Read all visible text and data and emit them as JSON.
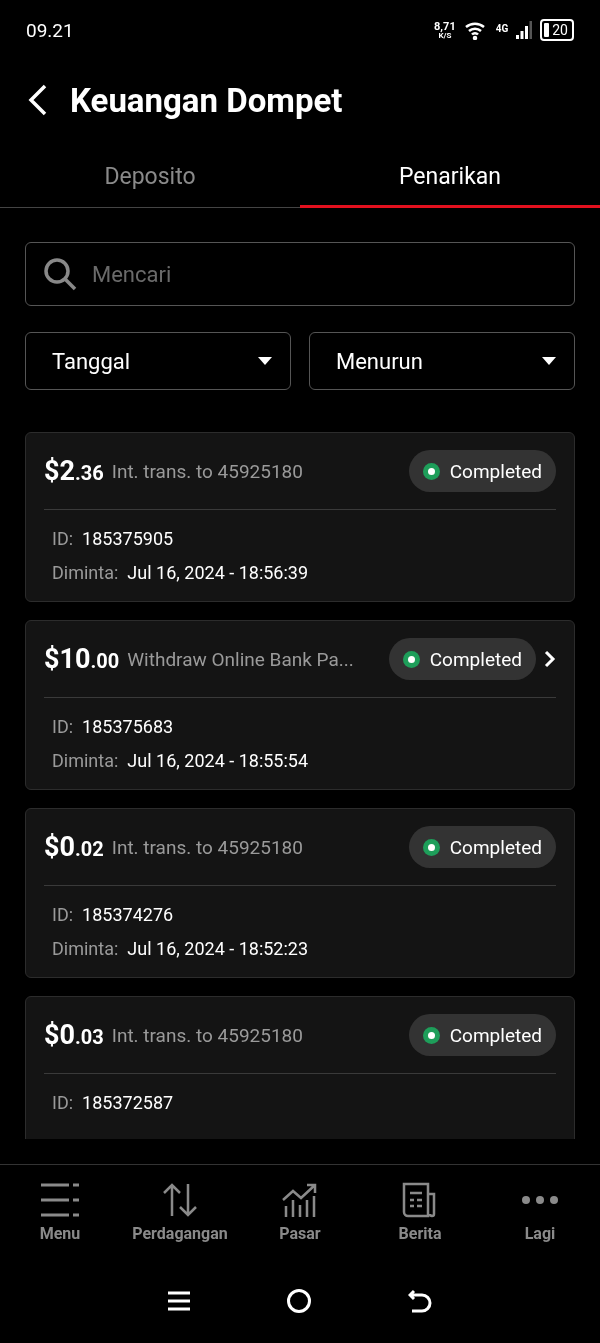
{
  "status_bar": {
    "time": "09.21",
    "speed": "8,71",
    "speed_unit": "K/S",
    "network": "4G",
    "battery": "20"
  },
  "header": {
    "title": "Keuangan Dompet"
  },
  "tabs": [
    {
      "label": "Deposito",
      "selected": false
    },
    {
      "label": "Penarikan",
      "selected": true
    }
  ],
  "search": {
    "placeholder": "Mencari"
  },
  "filters": [
    {
      "value": "Tanggal"
    },
    {
      "value": "Menurun"
    }
  ],
  "transactions": [
    {
      "amount": "$2.36",
      "description": "Int. trans. to 45925180",
      "status": "Completed",
      "color": "#1e9e5a",
      "has_arrow": false,
      "id_label": "ID:",
      "id": "185375905",
      "requested_label": "Diminta:",
      "requested": "Jul 16, 2024 - 18:56:39"
    },
    {
      "amount": "$10.00",
      "description": "Withdraw Online Bank Pa...",
      "status": "Completed",
      "color": "#1e9e5a",
      "has_arrow": true,
      "id_label": "ID:",
      "id": "185375683",
      "requested_label": "Diminta:",
      "requested": "Jul 16, 2024 - 18:55:54"
    },
    {
      "amount": "$0.02",
      "description": "Int. trans. to 45925180",
      "status": "Completed",
      "color": "#1e9e5a",
      "has_arrow": false,
      "id_label": "ID:",
      "id": "185374276",
      "requested_label": "Diminta:",
      "requested": "Jul 16, 2024 - 18:52:23"
    },
    {
      "amount": "$0.03",
      "description": "Int. trans. to 45925180",
      "status": "Completed",
      "color": "#1e9e5a",
      "has_arrow": false,
      "id_label": "ID:",
      "id": "185372587"
    }
  ],
  "bottom_nav": [
    {
      "kind": "menu",
      "label": "Menu"
    },
    {
      "kind": "trade",
      "label": "Perdagangan"
    },
    {
      "kind": "market",
      "label": "Pasar"
    },
    {
      "kind": "news",
      "label": "Berita"
    },
    {
      "kind": "more",
      "label": "Lagi"
    }
  ]
}
